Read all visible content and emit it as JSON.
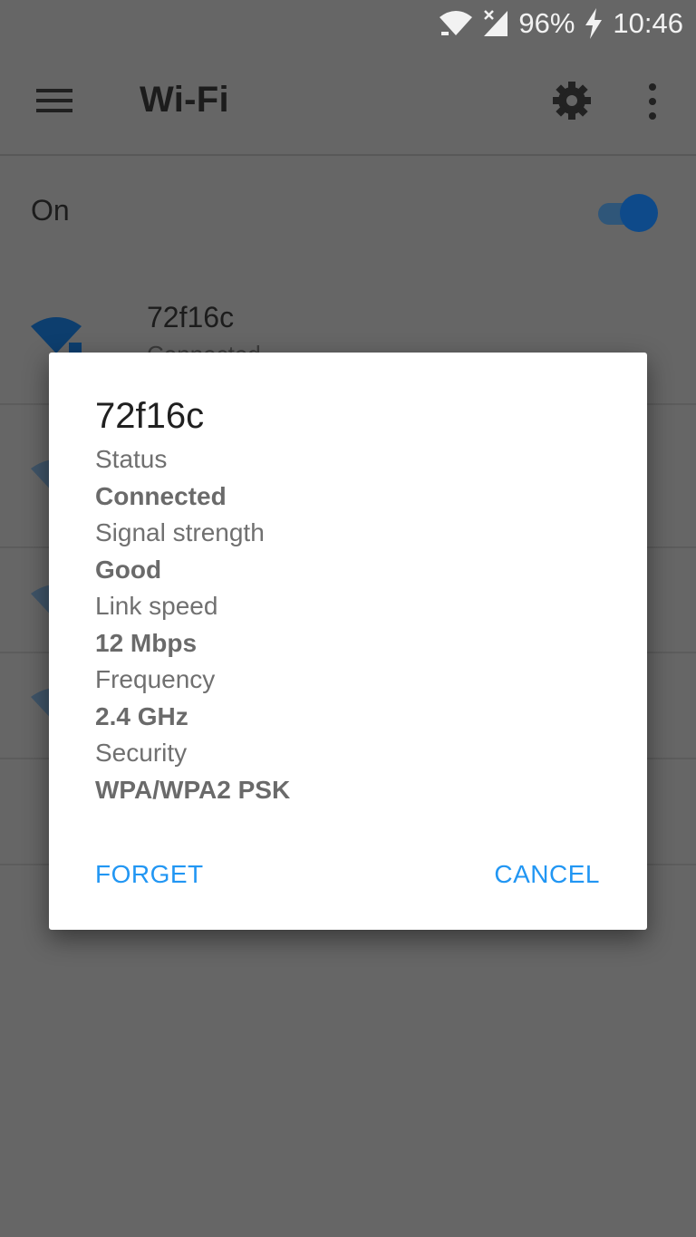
{
  "status_bar": {
    "battery": "96%",
    "time": "10:46",
    "icons": [
      "wifi-icon",
      "no-signal-icon",
      "charging-icon"
    ]
  },
  "app_bar": {
    "title": "Wi-Fi",
    "icons": [
      "hamburger-menu-icon",
      "gear-icon",
      "overflow-menu-icon"
    ]
  },
  "wifi_toggle": {
    "label": "On",
    "enabled": true
  },
  "networks": [
    {
      "ssid": "72f16c",
      "status": "Connected"
    }
  ],
  "dialog": {
    "title": "72f16c",
    "fields": [
      {
        "label": "Status",
        "value": "Connected"
      },
      {
        "label": "Signal strength",
        "value": "Good"
      },
      {
        "label": "Link speed",
        "value": "12 Mbps"
      },
      {
        "label": "Frequency",
        "value": "2.4 GHz"
      },
      {
        "label": "Security",
        "value": "WPA/WPA2 PSK"
      }
    ],
    "forget_label": "FORGET",
    "cancel_label": "CANCEL"
  },
  "colors": {
    "accent": "#2196f3",
    "scrim_background": "#666666",
    "toggle_on": "#0e4a8a"
  }
}
